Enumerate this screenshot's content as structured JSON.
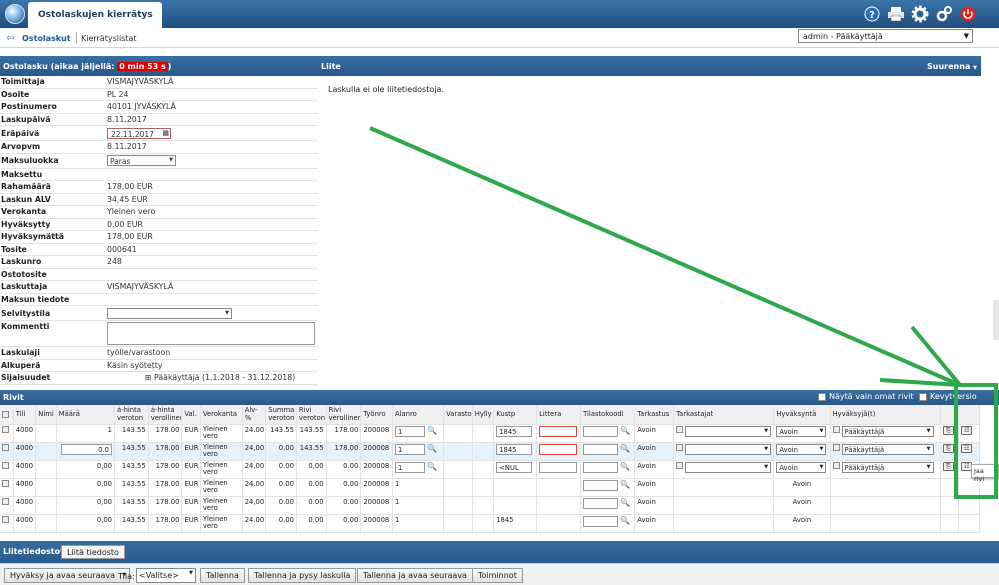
{
  "app": {
    "tab_title": "Ostolaskujen kierrätys"
  },
  "nav": {
    "link1": "Ostolaskut",
    "link2": "Kierrätyslistat",
    "user": "admin - Pääkäyttäjä"
  },
  "invoice_header": {
    "title": "Ostolasku (aikaa jäljellä: ",
    "timer": "0 min 53 s",
    "close": ")"
  },
  "attachment_header": {
    "title": "Liite",
    "enlarge": "Suurenna"
  },
  "attachment": {
    "empty_text": "Laskulla ei ole liitetiedostoja."
  },
  "fields": [
    {
      "label": "Toimittaja",
      "value": "VISMAJYVÄSKYLÄ"
    },
    {
      "label": "Osoite",
      "value": "PL 24"
    },
    {
      "label": "Postinumero",
      "value": "40101 JYVÄSKYLÄ"
    },
    {
      "label": "Laskupäivä",
      "value": "8.11.2017"
    },
    {
      "label": "Eräpäivä",
      "value": "22.11.2017"
    },
    {
      "label": "Arvopvm",
      "value": "8.11.2017"
    },
    {
      "label": "Maksuluokka",
      "value": "Paras"
    },
    {
      "label": "Maksettu",
      "value": ""
    },
    {
      "label": "Rahamäärä",
      "value": "178,00 EUR"
    },
    {
      "label": "Laskun ALV",
      "value": "34,45 EUR"
    },
    {
      "label": "Verokanta",
      "value": "Yleinen vero"
    },
    {
      "label": "Hyväksytty",
      "value": "0,00 EUR"
    },
    {
      "label": "Hyväksymättä",
      "value": "178,00 EUR"
    },
    {
      "label": "Tosite",
      "value": "000641"
    },
    {
      "label": "Laskunro",
      "value": "248"
    },
    {
      "label": "Ostotosite",
      "value": ""
    },
    {
      "label": "Laskuttaja",
      "value": "VISMAJYVÄSKYLÄ"
    },
    {
      "label": "Maksun tiedote",
      "value": ""
    },
    {
      "label": "Selvitystila",
      "value": ""
    },
    {
      "label": "Kommentti",
      "value": ""
    },
    {
      "label": "Laskulaji",
      "value": "työlle/varastoon"
    },
    {
      "label": "Alkuperä",
      "value": "Käsin syötetty"
    },
    {
      "label": "Sijaisuudet",
      "value": "Pääkäyttäjä (1.1.2018 - 31.12.2018)"
    }
  ],
  "rivit": {
    "title": "Rivit",
    "own_rows": "Näytä vain omat rivit",
    "light_version": "Kevytversio"
  },
  "columns": [
    "Tili",
    "Nimi",
    "Määrä",
    "á-hinta veroton",
    "á-hinta verollinen",
    "Val.",
    "Verokanta",
    "Alv-%",
    "Summa veroton",
    "Rivi veroton",
    "Rivi verollinen",
    "Työnro",
    "Alanro",
    "Varasto",
    "Hylly",
    "Kustp",
    "Littera",
    "Tilastokoodi",
    "Tarkastus",
    "Tarkastajat",
    "Hyväksyntä",
    "Hyväksyjä(t)"
  ],
  "rows": [
    {
      "tili": "4000",
      "maara": "1",
      "ahv": "143.55",
      "ahvl": "178.00",
      "val": "EUR",
      "vero": "Yleinen vero",
      "alv": "24.00",
      "summa": "143.55",
      "rv": "143.55",
      "rvl": "178.00",
      "tyo": "200008",
      "alanro": "1",
      "kustp": "1845",
      "tarkastus": "Avoin",
      "hyv": "Avoin",
      "hyvajat": "Pääkäyttäjä"
    },
    {
      "tili": "4000",
      "maara": "0.0",
      "ahv": "143.55",
      "ahvl": "178.00",
      "val": "EUR",
      "vero": "Yleinen vero",
      "alv": "24,00",
      "summa": "0.00",
      "rv": "143.55",
      "rvl": "178.00",
      "tyo": "200008",
      "alanro": "1",
      "kustp": "1845",
      "tarkastus": "Avoin",
      "hyv": "Avoin",
      "hyvajat": "Pääkäyttäjä"
    },
    {
      "tili": "4000",
      "maara": "0,00",
      "ahv": "143.55",
      "ahvl": "178.00",
      "val": "EUR",
      "vero": "Yleinen vero",
      "alv": "24,00",
      "summa": "0.00",
      "rv": "0,00",
      "rvl": "0.00",
      "tyo": "200008",
      "alanro": "1",
      "kustp": "<NUL",
      "tarkastus": "Avoin",
      "hyv": "Avoin",
      "hyvajat": "Pääkäyttäjä"
    },
    {
      "tili": "4000",
      "maara": "0,00",
      "ahv": "143.55",
      "ahvl": "178.00",
      "val": "EUR",
      "vero": "Yleinen vero",
      "alv": "24.00",
      "summa": "0.00",
      "rv": "0.00",
      "rvl": "0.00",
      "tyo": "200008",
      "alanro": "1",
      "kustp": "",
      "tarkastus": "Avoin",
      "hyv": "Avoin",
      "hyvajat": ""
    },
    {
      "tili": "4000",
      "maara": "0,00",
      "ahv": "143.55",
      "ahvl": "178.00",
      "val": "EUR",
      "vero": "Yleinen vero",
      "alv": "24,00",
      "summa": "0.00",
      "rv": "0.00",
      "rvl": "0.00",
      "tyo": "200008",
      "alanro": "1",
      "kustp": "",
      "tarkastus": "Avoin",
      "hyv": "Avoin",
      "hyvajat": ""
    },
    {
      "tili": "4000",
      "maara": "0,00",
      "ahv": "143.55",
      "ahvl": "178.00",
      "val": "EUR",
      "vero": "Yleinen vero",
      "alv": "24.00",
      "summa": "0.00",
      "rv": "0.00",
      "rvl": "0.00",
      "tyo": "200008",
      "alanro": "1",
      "kustp": "1845",
      "tarkastus": "Avoin",
      "hyv": "Avoin",
      "hyvajat": ""
    }
  ],
  "tooltip": "Jaa rivi",
  "attach_footer": {
    "title": "Liitetiedostot",
    "button": "Liitä tiedosto"
  },
  "actions": {
    "approve_next": "Hyväksy ja avaa seuraava",
    "tila_label": "Tila:",
    "tila_value": "<Valitse>",
    "save": "Tallenna",
    "save_stay": "Tallenna ja pysy laskulla",
    "save_next": "Tallenna ja avaa seuraava",
    "functions": "Toiminnot"
  },
  "colors": {
    "header_blue": "#27588a",
    "timer_red": "#dd0000",
    "arrow_green": "#2ea84a"
  }
}
